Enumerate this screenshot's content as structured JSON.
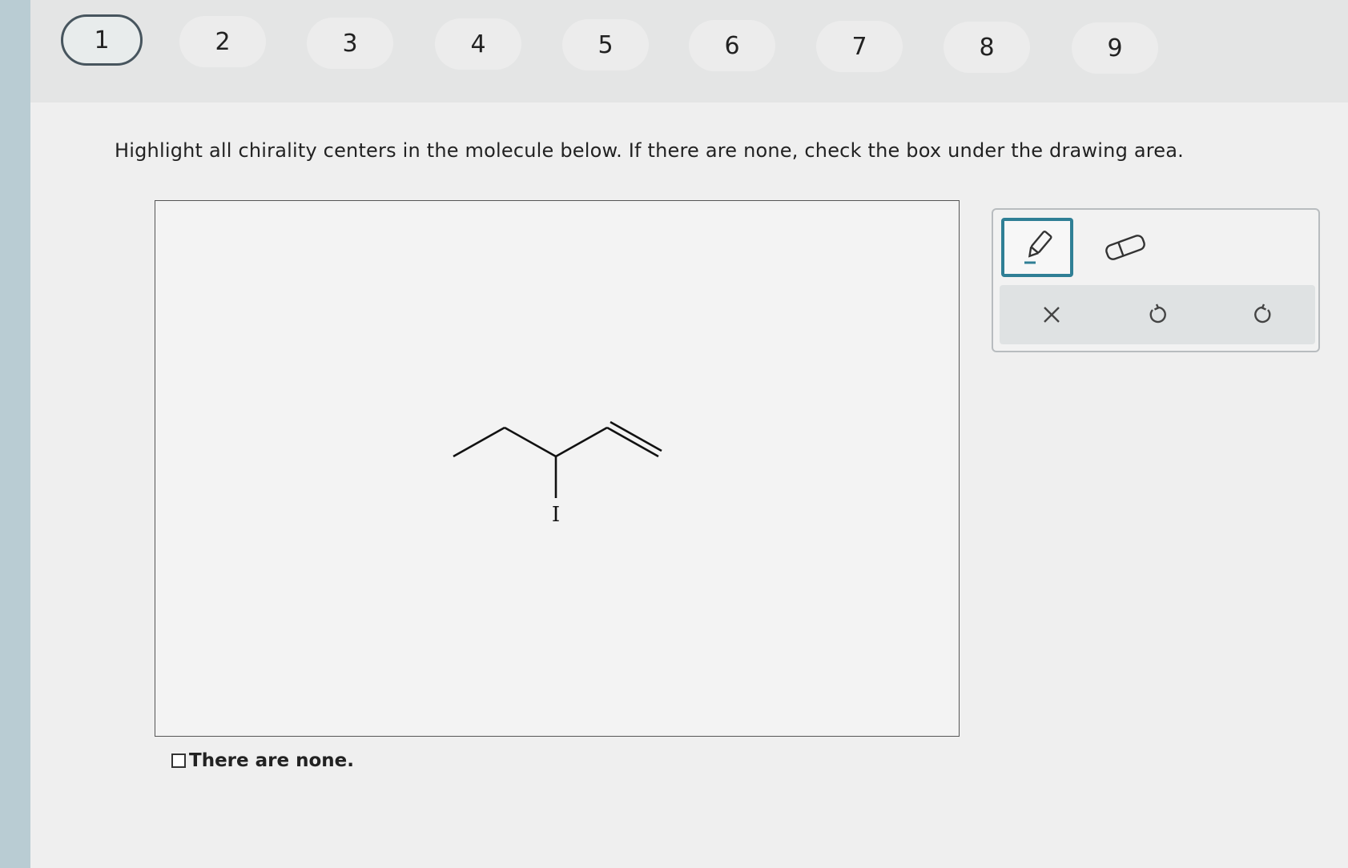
{
  "tabs": [
    {
      "label": "1",
      "active": true
    },
    {
      "label": "2",
      "active": false
    },
    {
      "label": "3",
      "active": false
    },
    {
      "label": "4",
      "active": false
    },
    {
      "label": "5",
      "active": false
    },
    {
      "label": "6",
      "active": false
    },
    {
      "label": "7",
      "active": false
    },
    {
      "label": "8",
      "active": false
    },
    {
      "label": "9",
      "active": false
    }
  ],
  "question": {
    "text": "Highlight all chirality centers in the molecule below. If there are none, check the box under the drawing area."
  },
  "molecule": {
    "atom_label": "I"
  },
  "none_option": {
    "label": "There are none.",
    "checked": false
  },
  "toolbox": {
    "tools": [
      "highlighter-icon",
      "eraser-icon"
    ],
    "selected_tool": "highlighter-icon",
    "actions": [
      "clear-icon",
      "undo-icon",
      "redo-icon"
    ],
    "accent_color": "#2f7f95"
  }
}
